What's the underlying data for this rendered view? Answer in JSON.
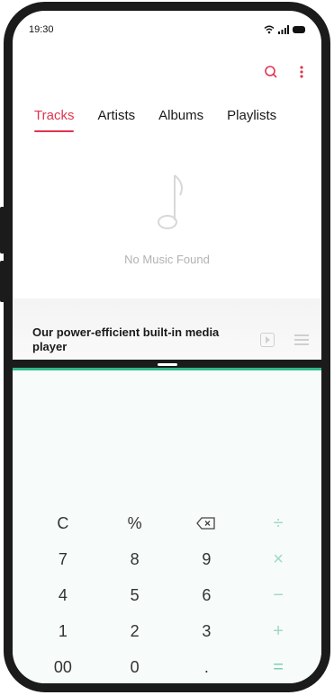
{
  "status_bar": {
    "time": "19:30",
    "icons": [
      "wifi-icon",
      "signal-icon",
      "battery-icon"
    ]
  },
  "toolbar": {
    "icons": [
      "search-icon",
      "more-icon"
    ]
  },
  "tabs": [
    {
      "label": "Tracks",
      "active": true
    },
    {
      "label": "Artists",
      "active": false
    },
    {
      "label": "Albums",
      "active": false
    },
    {
      "label": "Playlists",
      "active": false
    }
  ],
  "empty_state": {
    "icon": "music-note-icon",
    "text": "No Music Found"
  },
  "mini_player": {
    "title": "Our power-efficient built-in media player",
    "controls": [
      "play-icon",
      "playlist-icon"
    ]
  },
  "calculator": {
    "keys": [
      [
        "C",
        "%",
        "⌫",
        "÷"
      ],
      [
        "7",
        "8",
        "9",
        "×"
      ],
      [
        "4",
        "5",
        "6",
        "−"
      ],
      [
        "1",
        "2",
        "3",
        "+"
      ],
      [
        "00",
        "0",
        ".",
        "="
      ]
    ]
  },
  "colors": {
    "accent": "#e0354f",
    "operator": "#9fd9c6",
    "divider_accent": "#2fb98a"
  }
}
